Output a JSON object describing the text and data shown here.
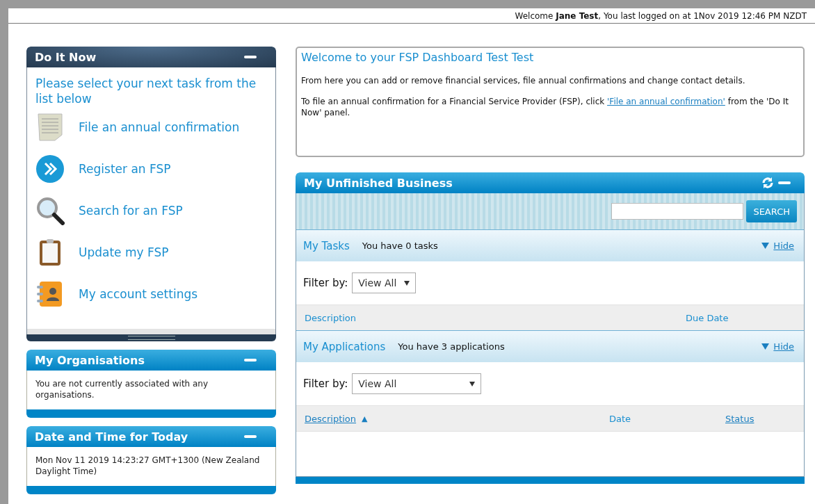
{
  "header": {
    "welcome": "Welcome **Jane Test**, You last logged on at 1Nov 2019 12:46 PM NZDT"
  },
  "do_it_now": {
    "title": "Do It Now",
    "intro": "Please select your next task from the list below",
    "items": [
      {
        "label": "File an annual confirmation",
        "kind": "document"
      },
      {
        "label": "Register an FSP",
        "kind": "forward"
      },
      {
        "label": "Search for an FSP",
        "kind": "search"
      },
      {
        "label": "Update my FSP",
        "kind": "clipboard"
      },
      {
        "label": "My account settings",
        "kind": "contacts"
      }
    ]
  },
  "side_panels": [
    {
      "title": "My Organisations",
      "text": "You are not currently associated with any organisations."
    },
    {
      "title": "Date and Time for Today",
      "text": "Mon Nov 11 2019 14:23:27 GMT+1300 (New Zealand Daylight Time)"
    }
  ],
  "welcome_box": {
    "title": "Welcome to your FSP Dashboard Test Test",
    "line_1": "From here you can add or remove financial services, file annual confirmations and change contact details.",
    "line_2_before": "To file an annual confirmation for a Financial Service Provider (FSP), click",
    "line_2_link": "'File an annual confirmation'",
    "line_2_after": "from the 'Do It Now' panel."
  },
  "business": {
    "title": "My Unfinished Business",
    "search_button": "SEARCH",
    "sections": [
      {
        "title": "My Tasks",
        "summary": "You have 0 tasks",
        "hide": "Hide",
        "filter_label": "Filter by:",
        "filter_value": "View All",
        "wide": false,
        "columns": [
          {
            "label": "Description",
            "link": false
          },
          {
            "label": "Due Date",
            "link": false
          }
        ]
      },
      {
        "title": "My Applications",
        "summary": "You have 3 applications",
        "hide": "Hide",
        "filter_label": "Filter by:",
        "filter_value": "View All",
        "wide": true,
        "columns": [
          {
            "label": "Description",
            "link": true,
            "sort_arrow": "▲"
          },
          {
            "label": "Date",
            "link": false
          },
          {
            "label": "Status",
            "link": true
          }
        ]
      }
    ]
  }
}
